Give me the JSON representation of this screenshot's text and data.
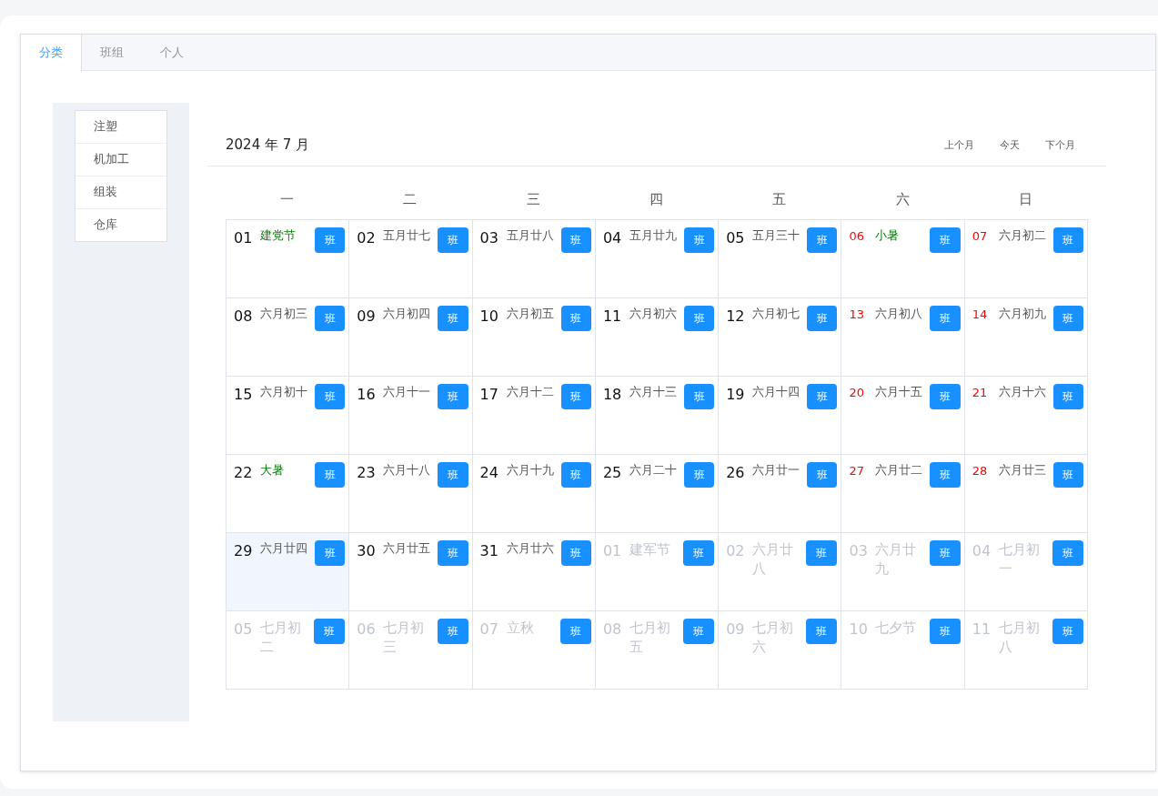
{
  "tabs": [
    {
      "label": "分类",
      "selected": true
    },
    {
      "label": "班组",
      "selected": false
    },
    {
      "label": "个人",
      "selected": false
    }
  ],
  "categories": [
    {
      "label": "注塑"
    },
    {
      "label": "机加工"
    },
    {
      "label": "组装"
    },
    {
      "label": "仓库"
    }
  ],
  "calendar": {
    "title": "2024 年 7 月",
    "nav": [
      "上个月",
      "今天",
      "下个月"
    ],
    "weekdays": [
      "一",
      "二",
      "三",
      "四",
      "五",
      "六",
      "日"
    ],
    "days": [
      {
        "day": "01",
        "lunar": "建党节",
        "festival": true,
        "weekend": false,
        "outside": false,
        "selected": false,
        "badge": "班"
      },
      {
        "day": "02",
        "lunar": "五月廿七",
        "festival": false,
        "weekend": false,
        "outside": false,
        "selected": false,
        "badge": "班"
      },
      {
        "day": "03",
        "lunar": "五月廿八",
        "festival": false,
        "weekend": false,
        "outside": false,
        "selected": false,
        "badge": "班"
      },
      {
        "day": "04",
        "lunar": "五月廿九",
        "festival": false,
        "weekend": false,
        "outside": false,
        "selected": false,
        "badge": "班"
      },
      {
        "day": "05",
        "lunar": "五月三十",
        "festival": false,
        "weekend": false,
        "outside": false,
        "selected": false,
        "badge": "班"
      },
      {
        "day": "06",
        "lunar": "小暑",
        "festival": true,
        "weekend": true,
        "outside": false,
        "selected": false,
        "badge": "班"
      },
      {
        "day": "07",
        "lunar": "六月初二",
        "festival": false,
        "weekend": true,
        "outside": false,
        "selected": false,
        "badge": "班"
      },
      {
        "day": "08",
        "lunar": "六月初三",
        "festival": false,
        "weekend": false,
        "outside": false,
        "selected": false,
        "badge": "班"
      },
      {
        "day": "09",
        "lunar": "六月初四",
        "festival": false,
        "weekend": false,
        "outside": false,
        "selected": false,
        "badge": "班"
      },
      {
        "day": "10",
        "lunar": "六月初五",
        "festival": false,
        "weekend": false,
        "outside": false,
        "selected": false,
        "badge": "班"
      },
      {
        "day": "11",
        "lunar": "六月初六",
        "festival": false,
        "weekend": false,
        "outside": false,
        "selected": false,
        "badge": "班"
      },
      {
        "day": "12",
        "lunar": "六月初七",
        "festival": false,
        "weekend": false,
        "outside": false,
        "selected": false,
        "badge": "班"
      },
      {
        "day": "13",
        "lunar": "六月初八",
        "festival": false,
        "weekend": true,
        "outside": false,
        "selected": false,
        "badge": "班"
      },
      {
        "day": "14",
        "lunar": "六月初九",
        "festival": false,
        "weekend": true,
        "outside": false,
        "selected": false,
        "badge": "班"
      },
      {
        "day": "15",
        "lunar": "六月初十",
        "festival": false,
        "weekend": false,
        "outside": false,
        "selected": false,
        "badge": "班"
      },
      {
        "day": "16",
        "lunar": "六月十一",
        "festival": false,
        "weekend": false,
        "outside": false,
        "selected": false,
        "badge": "班"
      },
      {
        "day": "17",
        "lunar": "六月十二",
        "festival": false,
        "weekend": false,
        "outside": false,
        "selected": false,
        "badge": "班"
      },
      {
        "day": "18",
        "lunar": "六月十三",
        "festival": false,
        "weekend": false,
        "outside": false,
        "selected": false,
        "badge": "班"
      },
      {
        "day": "19",
        "lunar": "六月十四",
        "festival": false,
        "weekend": false,
        "outside": false,
        "selected": false,
        "badge": "班"
      },
      {
        "day": "20",
        "lunar": "六月十五",
        "festival": false,
        "weekend": true,
        "outside": false,
        "selected": false,
        "badge": "班"
      },
      {
        "day": "21",
        "lunar": "六月十六",
        "festival": false,
        "weekend": true,
        "outside": false,
        "selected": false,
        "badge": "班"
      },
      {
        "day": "22",
        "lunar": "大暑",
        "festival": true,
        "weekend": false,
        "outside": false,
        "selected": false,
        "badge": "班"
      },
      {
        "day": "23",
        "lunar": "六月十八",
        "festival": false,
        "weekend": false,
        "outside": false,
        "selected": false,
        "badge": "班"
      },
      {
        "day": "24",
        "lunar": "六月十九",
        "festival": false,
        "weekend": false,
        "outside": false,
        "selected": false,
        "badge": "班"
      },
      {
        "day": "25",
        "lunar": "六月二十",
        "festival": false,
        "weekend": false,
        "outside": false,
        "selected": false,
        "badge": "班"
      },
      {
        "day": "26",
        "lunar": "六月廿一",
        "festival": false,
        "weekend": false,
        "outside": false,
        "selected": false,
        "badge": "班"
      },
      {
        "day": "27",
        "lunar": "六月廿二",
        "festival": false,
        "weekend": true,
        "outside": false,
        "selected": false,
        "badge": "班"
      },
      {
        "day": "28",
        "lunar": "六月廿三",
        "festival": false,
        "weekend": true,
        "outside": false,
        "selected": false,
        "badge": "班"
      },
      {
        "day": "29",
        "lunar": "六月廿四",
        "festival": false,
        "weekend": false,
        "outside": false,
        "selected": true,
        "badge": "班"
      },
      {
        "day": "30",
        "lunar": "六月廿五",
        "festival": false,
        "weekend": false,
        "outside": false,
        "selected": false,
        "badge": "班"
      },
      {
        "day": "31",
        "lunar": "六月廿六",
        "festival": false,
        "weekend": false,
        "outside": false,
        "selected": false,
        "badge": "班"
      },
      {
        "day": "01",
        "lunar": "建军节",
        "outside": true,
        "selected": false,
        "badge": "班"
      },
      {
        "day": "02",
        "lunar": "六月廿八",
        "outside": true,
        "selected": false,
        "badge": "班"
      },
      {
        "day": "03",
        "lunar": "六月廿九",
        "outside": true,
        "selected": false,
        "badge": "班"
      },
      {
        "day": "04",
        "lunar": "七月初一",
        "outside": true,
        "selected": false,
        "badge": "班"
      },
      {
        "day": "05",
        "lunar": "七月初二",
        "outside": true,
        "selected": false,
        "badge": "班"
      },
      {
        "day": "06",
        "lunar": "七月初三",
        "outside": true,
        "selected": false,
        "badge": "班"
      },
      {
        "day": "07",
        "lunar": "立秋",
        "outside": true,
        "selected": false,
        "badge": "班"
      },
      {
        "day": "08",
        "lunar": "七月初五",
        "outside": true,
        "selected": false,
        "badge": "班"
      },
      {
        "day": "09",
        "lunar": "七月初六",
        "outside": true,
        "selected": false,
        "badge": "班"
      },
      {
        "day": "10",
        "lunar": "七夕节",
        "outside": true,
        "selected": false,
        "badge": "班"
      },
      {
        "day": "11",
        "lunar": "七月初八",
        "outside": true,
        "selected": false,
        "badge": "班"
      }
    ]
  }
}
